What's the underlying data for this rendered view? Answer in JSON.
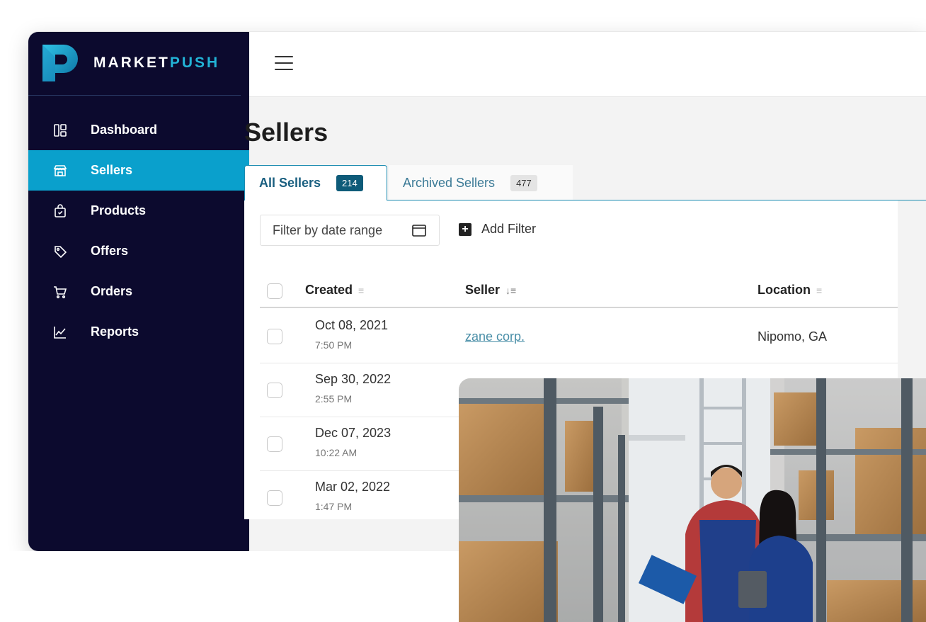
{
  "brand": {
    "name_part1": "MARKET",
    "name_part2": "PUSH"
  },
  "sidebar": {
    "items": [
      {
        "label": "Dashboard",
        "icon": "dashboard-icon",
        "active": false
      },
      {
        "label": "Sellers",
        "icon": "store-icon",
        "active": true
      },
      {
        "label": "Products",
        "icon": "bag-icon",
        "active": false
      },
      {
        "label": "Offers",
        "icon": "tag-icon",
        "active": false
      },
      {
        "label": "Orders",
        "icon": "cart-icon",
        "active": false
      },
      {
        "label": "Reports",
        "icon": "chart-icon",
        "active": false
      }
    ]
  },
  "header": {
    "menu_icon": "hamburger-icon"
  },
  "main": {
    "title": "Sellers",
    "tabs": [
      {
        "label": "All Sellers",
        "count": "214"
      },
      {
        "label": "Archived Sellers",
        "count": "477"
      }
    ],
    "filters": {
      "date_placeholder": "Filter by date range",
      "add_filter_label": "Add Filter"
    },
    "table": {
      "columns": [
        "Created",
        "Seller",
        "Location"
      ],
      "rows": [
        {
          "date": "Oct 08, 2021",
          "time": "7:50 PM",
          "seller": "zane corp.",
          "location": "Nipomo, GA"
        },
        {
          "date": "Sep 30, 2022",
          "time": "2:55 PM",
          "seller": "",
          "location": ""
        },
        {
          "date": "Dec 07, 2023",
          "time": "10:22 AM",
          "seller": "",
          "location": ""
        },
        {
          "date": "Mar 02, 2022",
          "time": "1:47 PM",
          "seller": "",
          "location": ""
        }
      ]
    }
  },
  "colors": {
    "sidebar_bg": "#0c0a2e",
    "active_nav": "#0aa0cc",
    "brand_accent": "#22b3d6",
    "badge_dark": "#0e5b79"
  }
}
